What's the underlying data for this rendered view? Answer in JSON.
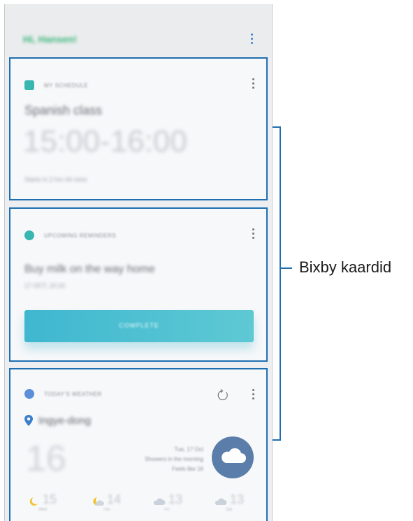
{
  "header": {
    "greeting": "Hi, Hansen!"
  },
  "cards": {
    "schedule": {
      "label": "MY SCHEDULE",
      "title": "Spanish class",
      "time": "15:00-16:00",
      "subtitle": "Starts in 2 hrs 44 mins"
    },
    "reminder": {
      "label": "UPCOMING REMINDERS",
      "title": "Buy milk on the way home",
      "date": "17 OCT, 10:16",
      "button_label": "COMPLETE"
    },
    "weather": {
      "label": "TODAY'S WEATHER",
      "location": "Ingye-dong",
      "temperature": "16",
      "description_lines": [
        "Tue, 17 Oct",
        "Showers in the morning",
        "Feels like 16"
      ],
      "forecast": [
        {
          "icon": "moon-icon",
          "temp": "15",
          "day": "Wed"
        },
        {
          "icon": "moon-cloud-icon",
          "temp": "14",
          "day": "Thu"
        },
        {
          "icon": "cloud-icon",
          "temp": "13",
          "day": "Fri"
        },
        {
          "icon": "cloud-icon",
          "temp": "13",
          "day": "Sat"
        }
      ]
    }
  },
  "callout": {
    "label": "Bixby kaardid"
  },
  "colors": {
    "highlight": "#1f6fb0",
    "accent_teal": "#38b6b0",
    "greeting": "#3cb87c"
  }
}
